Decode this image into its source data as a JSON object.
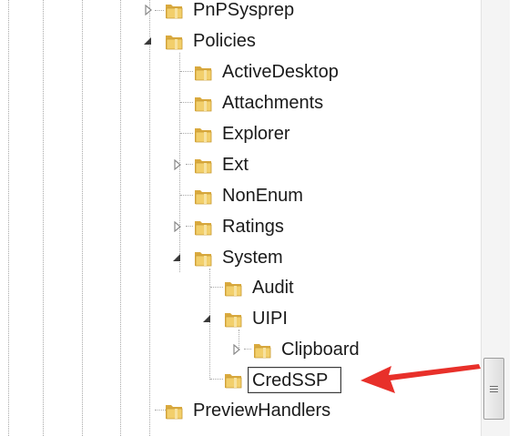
{
  "tree": {
    "nodes": [
      {
        "label": "PnPSysprep",
        "expander": "collapsed"
      },
      {
        "label": "Policies",
        "expander": "expanded"
      },
      {
        "label": "ActiveDesktop",
        "expander": "none"
      },
      {
        "label": "Attachments",
        "expander": "none"
      },
      {
        "label": "Explorer",
        "expander": "none"
      },
      {
        "label": "Ext",
        "expander": "collapsed"
      },
      {
        "label": "NonEnum",
        "expander": "none"
      },
      {
        "label": "Ratings",
        "expander": "collapsed"
      },
      {
        "label": "System",
        "expander": "expanded"
      },
      {
        "label": "Audit",
        "expander": "none"
      },
      {
        "label": "UIPI",
        "expander": "expanded"
      },
      {
        "label": "Clipboard",
        "expander": "collapsed"
      },
      {
        "label": "CredSSP",
        "expander": "none",
        "editing": true
      },
      {
        "label": "PreviewHandlers",
        "expander": "none"
      }
    ]
  },
  "annotation": {
    "arrow_color": "#e8302a"
  },
  "colors": {
    "folder_front": "#f2cf6b",
    "folder_back": "#d9a93e",
    "guide": "#a9a9a9"
  }
}
